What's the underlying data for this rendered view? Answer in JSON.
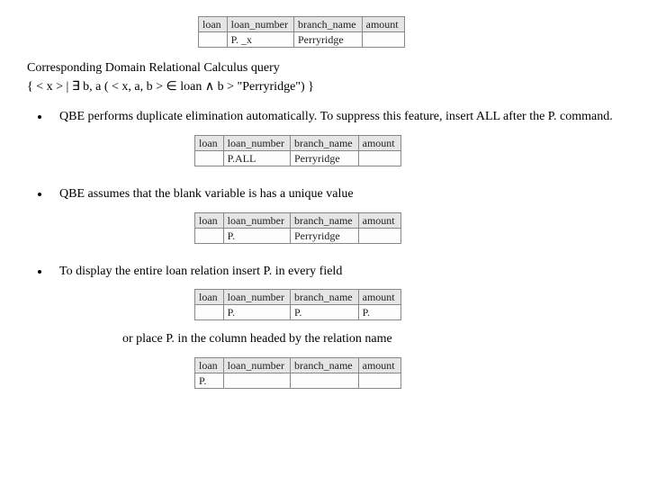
{
  "top_table": {
    "headers": [
      "loan",
      "loan_number",
      "branch_name",
      "amount"
    ],
    "row": [
      "",
      "P. _x",
      "Perryridge",
      ""
    ]
  },
  "intro": {
    "line1": "Corresponding Domain Relational Calculus query",
    "line2": "{ < x > | ∃  b, a ( < x, a, b > ∈   loan  ∧  b > \"Perryridge\") }"
  },
  "bullets": [
    {
      "text": "QBE performs duplicate elimination automatically.  To suppress this feature, insert ALL after the P. command.",
      "table": {
        "headers": [
          "loan",
          "loan_number",
          "branch_name",
          "amount"
        ],
        "row": [
          "",
          "P.ALL",
          "Perryridge",
          ""
        ]
      }
    },
    {
      "text": "QBE assumes that the blank variable is has a unique value",
      "table": {
        "headers": [
          "loan",
          "loan_number",
          "branch_name",
          "amount"
        ],
        "row": [
          "",
          "P.",
          "Perryridge",
          ""
        ]
      }
    },
    {
      "text": "To display the entire loan relation insert P. in every field",
      "table": {
        "headers": [
          "loan",
          "loan_number",
          "branch_name",
          "amount"
        ],
        "row": [
          "",
          "P.",
          "P.",
          "P."
        ]
      },
      "note": "or place P. in the column headed by the relation name",
      "note_table": {
        "headers": [
          "loan",
          "loan_number",
          "branch_name",
          "amount"
        ],
        "row": [
          "P.",
          "",
          "",
          ""
        ]
      }
    }
  ]
}
